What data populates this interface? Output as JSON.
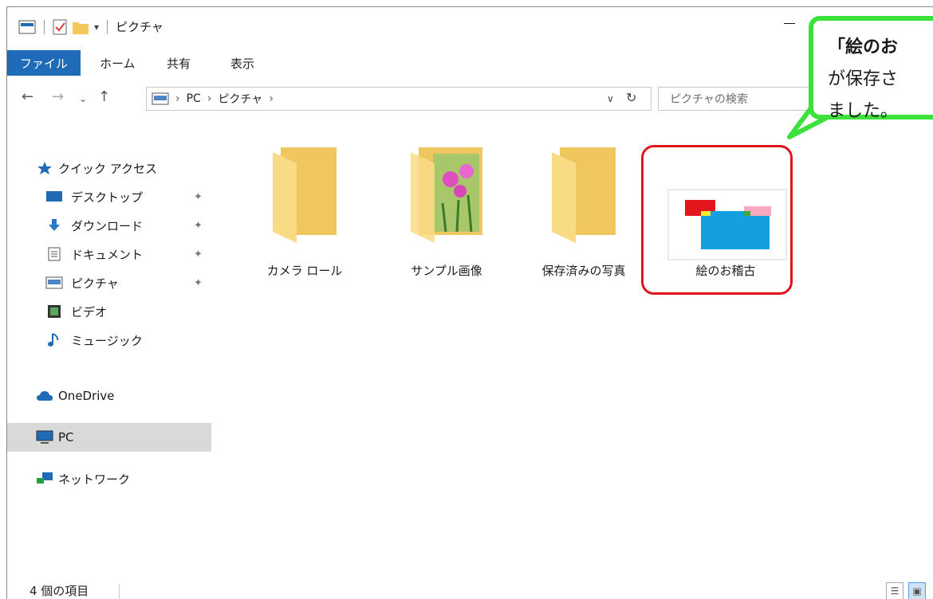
{
  "window": {
    "title": "ピクチャ"
  },
  "ribbon": {
    "tabs": [
      "ファイル",
      "ホーム",
      "共有",
      "表示"
    ]
  },
  "address": {
    "segments": [
      "PC",
      "ピクチャ"
    ],
    "search_placeholder": "ピクチャの検索"
  },
  "sidebar": {
    "items": [
      {
        "label": "クイック アクセス",
        "icon": "star-icon"
      },
      {
        "label": "デスクトップ",
        "icon": "desktop-icon",
        "pinned": true
      },
      {
        "label": "ダウンロード",
        "icon": "download-icon",
        "pinned": true
      },
      {
        "label": "ドキュメント",
        "icon": "document-icon",
        "pinned": true
      },
      {
        "label": "ピクチャ",
        "icon": "pictures-icon",
        "pinned": true
      },
      {
        "label": "ビデオ",
        "icon": "video-icon"
      },
      {
        "label": "ミュージック",
        "icon": "music-icon"
      },
      {
        "label": "OneDrive",
        "icon": "cloud-icon"
      },
      {
        "label": "PC",
        "icon": "pc-icon",
        "selected": true
      },
      {
        "label": "ネットワーク",
        "icon": "network-icon"
      }
    ]
  },
  "content": {
    "items": [
      {
        "label": "カメラ ロール",
        "icon": "folder-icon"
      },
      {
        "label": "サンプル画像",
        "icon": "folder-with-photo-icon"
      },
      {
        "label": "保存済みの写真",
        "icon": "folder-icon"
      },
      {
        "label": "絵のお稽古",
        "icon": "image-thumbnail-icon"
      }
    ]
  },
  "callout": {
    "lines": [
      "「絵のお",
      "が保存さ",
      "ました。"
    ]
  },
  "status": {
    "item_count": "4 個の項目"
  },
  "colors": {
    "accent": "#1f6bb8",
    "highlight_ring": "#e0141c",
    "callout_border": "#3be23b",
    "folder": "#f8d675"
  }
}
